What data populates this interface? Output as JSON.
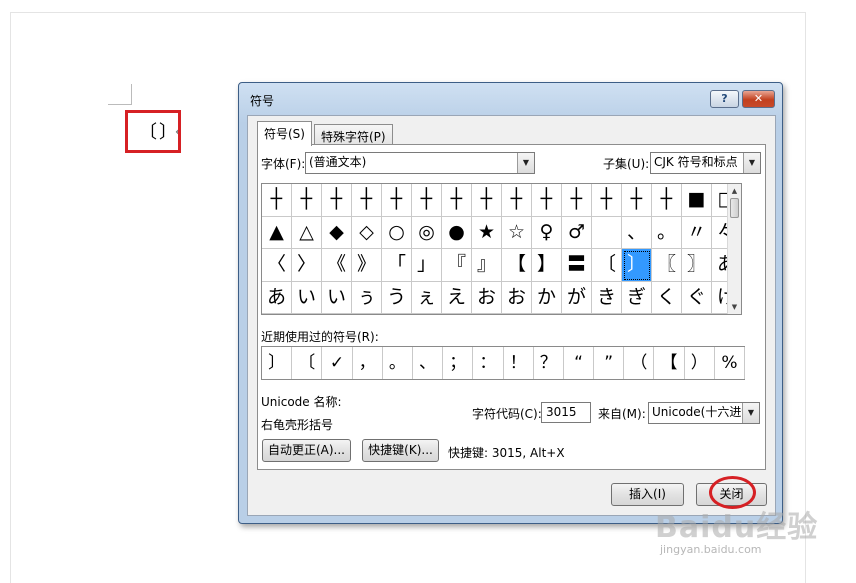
{
  "document": {
    "inserted_text": "〔〕",
    "paragraph_mark": "↲"
  },
  "dialog": {
    "title": "符号",
    "help_button": "?",
    "close_x": "✕",
    "tabs": [
      {
        "label": "符号(S)",
        "active": true
      },
      {
        "label": "特殊字符(P)",
        "active": false
      }
    ],
    "font_label": "字体(F):",
    "font_value": "(普通文本)",
    "subset_label": "子集(U):",
    "subset_value": "CJK 符号和标点",
    "symbols": [
      "┼",
      "┼",
      "┼",
      "┼",
      "┼",
      "┼",
      "┼",
      "┼",
      "┼",
      "┼",
      "┼",
      "┼",
      "┼",
      "┼",
      "■",
      "□",
      "▲",
      "△",
      "◆",
      "◇",
      "○",
      "◎",
      "●",
      "★",
      "☆",
      "♀",
      "♂",
      " ",
      "、",
      "。",
      "〃",
      "々",
      "〈",
      "〉",
      "《",
      "》",
      "「",
      "」",
      "『",
      "』",
      "【",
      "】",
      "〓",
      "〔",
      "〕",
      "〖",
      "〗",
      "あ",
      "あ",
      "い",
      "い",
      "ぅ",
      "う",
      "ぇ",
      "え",
      "お",
      "お",
      "か",
      "が",
      "き",
      "ぎ",
      "く",
      "ぐ",
      "け"
    ],
    "selected_symbol_index": 44,
    "recent_label": "近期使用过的符号(R):",
    "recent_symbols": [
      "〕",
      "〔",
      "✓",
      "，",
      "。",
      "、",
      "；",
      "：",
      "！",
      "？",
      "“",
      "”",
      "（",
      "【",
      "）",
      "%"
    ],
    "unicode_name_label": "Unicode 名称:",
    "unicode_name_value": "右龟壳形括号",
    "char_code_label": "字符代码(C):",
    "char_code_value": "3015",
    "from_label": "来自(M):",
    "from_value": "Unicode(十六进制)",
    "autocorrect_button": "自动更正(A)...",
    "shortcut_button": "快捷键(K)...",
    "shortcut_text": "快捷键: 3015, Alt+X",
    "insert_button": "插入(I)",
    "close_button": "关闭"
  },
  "watermark": {
    "brand": "Baidu经验",
    "url": "jingyan.baidu.com"
  },
  "colors": {
    "highlight_red": "#d62024",
    "selection_blue": "#3399ff"
  }
}
